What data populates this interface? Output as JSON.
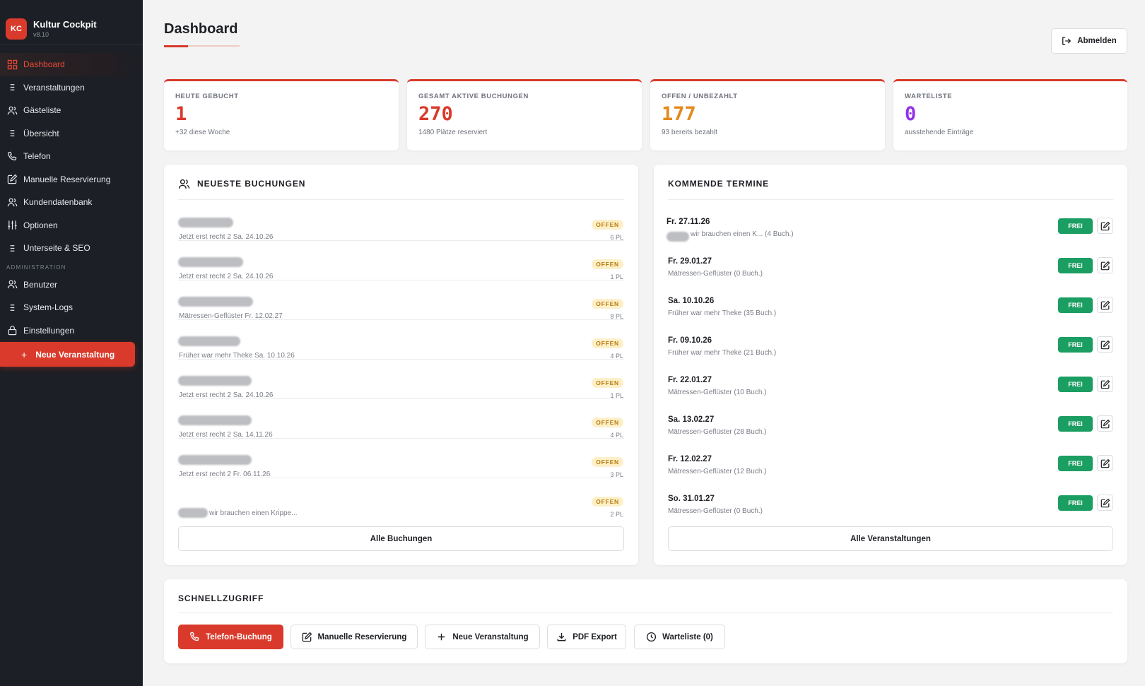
{
  "brand": {
    "logo": "KC",
    "name": "Kultur Cockpit",
    "version": "v8.10"
  },
  "nav": {
    "items": [
      {
        "label": "Dashboard",
        "icon": "grid-icon"
      },
      {
        "label": "Veranstaltungen",
        "icon": "list-icon"
      },
      {
        "label": "Gästeliste",
        "icon": "users-icon"
      },
      {
        "label": "Übersicht",
        "icon": "list-icon"
      },
      {
        "label": "Telefon",
        "icon": "phone-icon"
      },
      {
        "label": "Manuelle Reservierung",
        "icon": "edit-icon"
      },
      {
        "label": "Kundendatenbank",
        "icon": "users-icon"
      },
      {
        "label": "Optionen",
        "icon": "sliders-icon"
      },
      {
        "label": "Unterseite & SEO",
        "icon": "list-icon"
      }
    ],
    "section_admin": "ADMINISTRATION",
    "admin_items": [
      {
        "label": "Benutzer",
        "icon": "users-icon"
      },
      {
        "label": "System-Logs",
        "icon": "list-icon"
      },
      {
        "label": "Einstellungen",
        "icon": "lock-icon"
      }
    ],
    "cta": "Neue Veranstaltung"
  },
  "header": {
    "title": "Dashboard",
    "logout": "Abmelden"
  },
  "colors": {
    "accent": "#d93a2b",
    "orange": "#e38a1a",
    "purple": "#9333ea",
    "green": "#1b9e62"
  },
  "stats": [
    {
      "label": "HEUTE GEBUCHT",
      "value": "1",
      "sub": "+32 diese Woche",
      "color": "#d93a2b"
    },
    {
      "label": "GESAMT AKTIVE BUCHUNGEN",
      "value": "270",
      "sub": "1480 Plätze reserviert",
      "color": "#d93a2b"
    },
    {
      "label": "OFFEN / UNBEZAHLT",
      "value": "177",
      "sub": "93 bereits bezahlt",
      "color": "#e38a1a"
    },
    {
      "label": "WARTELISTE",
      "value": "0",
      "sub": "ausstehende Einträge",
      "color": "#9333ea"
    }
  ],
  "bookings": {
    "title": "NEUESTE BUCHUNGEN",
    "status": "OFFEN",
    "rows": [
      {
        "event": "Jetzt erst recht 2 Sa. 24.10.26",
        "seats": "6 PL"
      },
      {
        "event": "Jetzt erst recht 2 Sa. 24.10.26",
        "seats": "1 PL"
      },
      {
        "event": "Mätressen-Geflüster Fr. 12.02.27",
        "seats": "8 PL"
      },
      {
        "event": "Früher war mehr Theke Sa. 10.10.26",
        "seats": "4 PL"
      },
      {
        "event": "Jetzt erst recht 2 Sa. 24.10.26",
        "seats": "1 PL"
      },
      {
        "event": "Jetzt erst recht 2 Sa. 14.11.26",
        "seats": "4 PL"
      },
      {
        "event": "Jetzt erst recht 2 Fr. 06.11.26",
        "seats": "3 PL"
      },
      {
        "event": "wir brauchen einen Krippe...",
        "seats": "2 PL"
      }
    ],
    "button": "Alle Buchungen"
  },
  "events": {
    "title": "KOMMENDE TERMINE",
    "status": "FREI",
    "rows": [
      {
        "date": "Fr. 27.11.26",
        "sub": "wir brauchen einen K... (4 Buch.)"
      },
      {
        "date": "Fr. 29.01.27",
        "sub": "Mätressen-Geflüster (0 Buch.)"
      },
      {
        "date": "Sa. 10.10.26",
        "sub": "Früher war mehr Theke (35 Buch.)"
      },
      {
        "date": "Fr. 09.10.26",
        "sub": "Früher war mehr Theke (21 Buch.)"
      },
      {
        "date": "Fr. 22.01.27",
        "sub": "Mätressen-Geflüster (10 Buch.)"
      },
      {
        "date": "Sa. 13.02.27",
        "sub": "Mätressen-Geflüster (28 Buch.)"
      },
      {
        "date": "Fr. 12.02.27",
        "sub": "Mätressen-Geflüster (12 Buch.)"
      },
      {
        "date": "So. 31.01.27",
        "sub": "Mätressen-Geflüster (0 Buch.)"
      }
    ],
    "button": "Alle Veranstaltungen"
  },
  "quick": {
    "title": "SCHNELLZUGRIFF",
    "buttons": [
      {
        "label": "Telefon-Buchung",
        "icon": "phone-icon"
      },
      {
        "label": "Manuelle Reservierung",
        "icon": "edit-icon"
      },
      {
        "label": "Neue Veranstaltung",
        "icon": "plus-icon"
      },
      {
        "label": "PDF Export",
        "icon": "download-icon"
      },
      {
        "label": "Warteliste (0)",
        "icon": "clock-icon"
      }
    ]
  }
}
